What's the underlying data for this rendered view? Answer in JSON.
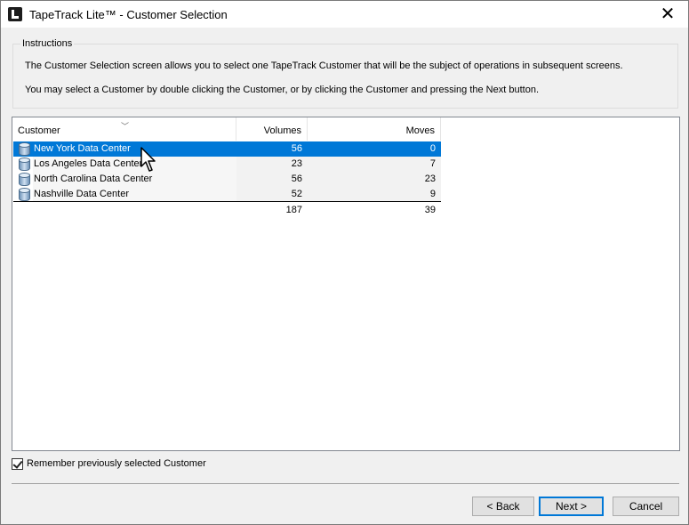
{
  "window": {
    "title": "TapeTrack Lite™ - Customer Selection",
    "close_glyph": "✕"
  },
  "instructions": {
    "legend": "Instructions",
    "line1": "The Customer Selection screen allows you to select one TapeTrack Customer that will be the subject of operations in subsequent screens.",
    "line2": "You may select a Customer by double clicking the Customer, or by clicking the Customer and pressing the Next button."
  },
  "table": {
    "columns": {
      "customer": "Customer",
      "volumes": "Volumes",
      "moves": "Moves"
    },
    "rows": [
      {
        "name": "New York Data Center",
        "volumes": "56",
        "moves": "0"
      },
      {
        "name": "Los Angeles Data Center",
        "volumes": "23",
        "moves": "7"
      },
      {
        "name": "North Carolina Data Center",
        "volumes": "56",
        "moves": "23"
      },
      {
        "name": "Nashville Data Center",
        "volumes": "52",
        "moves": "9"
      }
    ],
    "totals": {
      "volumes": "187",
      "moves": "39"
    },
    "selected_row": 0
  },
  "options": {
    "remember_label": "Remember previously selected Customer",
    "remember_checked": true
  },
  "buttons": {
    "back": "< Back",
    "next": "Next >",
    "cancel": "Cancel"
  },
  "icons": {
    "app": "tapetrack-logo-icon",
    "row": "database-icon",
    "sort": "sort-descending-icon"
  },
  "colors": {
    "selection": "#0078d7",
    "focus_border": "#0078d7"
  }
}
